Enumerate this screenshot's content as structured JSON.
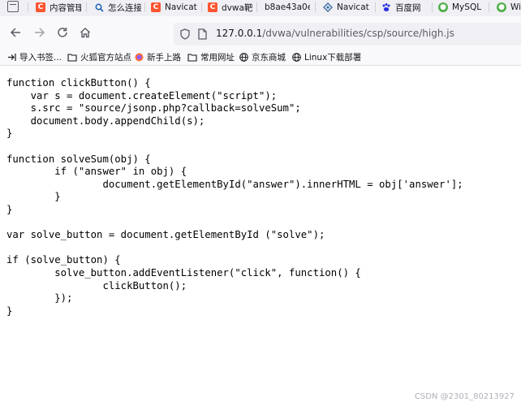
{
  "tabs": [
    {
      "label": "内容管理",
      "icon": "csdn-icon"
    },
    {
      "label": "怎么连接",
      "icon": "search-icon"
    },
    {
      "label": "Navicat",
      "icon": "csdn-icon"
    },
    {
      "label": "dvwa靶",
      "icon": "csdn-icon"
    },
    {
      "label": "b8ae43a0e",
      "icon": "none"
    },
    {
      "label": "Navicat",
      "icon": "navicat-icon"
    },
    {
      "label": "百度网",
      "icon": "baidu-icon"
    },
    {
      "label": "MySQL",
      "icon": "mysql-icon"
    },
    {
      "label": "Wi",
      "icon": "mysql-icon"
    }
  ],
  "navbar": {
    "url_host": "127.0.0.1",
    "url_path": "/dvwa/vulnerabilities/csp/source/high.js"
  },
  "bookmarks": [
    {
      "label": "导入书签...",
      "icon": "import-icon"
    },
    {
      "label": "火狐官方站点",
      "icon": "folder-icon"
    },
    {
      "label": "新手上路",
      "icon": "firefox-icon"
    },
    {
      "label": "常用网址",
      "icon": "folder-icon"
    },
    {
      "label": "京东商城",
      "icon": "globe-icon"
    },
    {
      "label": "Linux下载部署",
      "icon": "globe-icon"
    }
  ],
  "page": {
    "code": "function clickButton() {\n    var s = document.createElement(\"script\");\n    s.src = \"source/jsonp.php?callback=solveSum\";\n    document.body.appendChild(s);\n}\n\nfunction solveSum(obj) {\n\tif (\"answer\" in obj) {\n\t\tdocument.getElementById(\"answer\").innerHTML = obj['answer'];\n\t}\n}\n\nvar solve_button = document.getElementById (\"solve\");\n\nif (solve_button) {\n\tsolve_button.addEventListener(\"click\", function() {\n\t\tclickButton();\n\t});\n}"
  },
  "watermark": "CSDN @2301_80213927"
}
